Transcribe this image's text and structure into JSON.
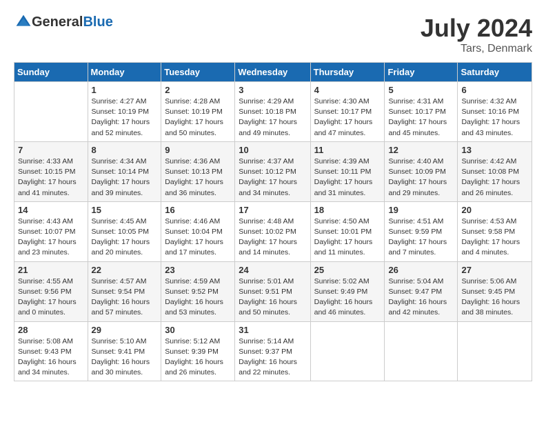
{
  "header": {
    "logo_general": "General",
    "logo_blue": "Blue",
    "month_year": "July 2024",
    "location": "Tars, Denmark"
  },
  "days_of_week": [
    "Sunday",
    "Monday",
    "Tuesday",
    "Wednesday",
    "Thursday",
    "Friday",
    "Saturday"
  ],
  "weeks": [
    [
      {
        "day": "",
        "sunrise": "",
        "sunset": "",
        "daylight": ""
      },
      {
        "day": "1",
        "sunrise": "Sunrise: 4:27 AM",
        "sunset": "Sunset: 10:19 PM",
        "daylight": "Daylight: 17 hours and 52 minutes."
      },
      {
        "day": "2",
        "sunrise": "Sunrise: 4:28 AM",
        "sunset": "Sunset: 10:19 PM",
        "daylight": "Daylight: 17 hours and 50 minutes."
      },
      {
        "day": "3",
        "sunrise": "Sunrise: 4:29 AM",
        "sunset": "Sunset: 10:18 PM",
        "daylight": "Daylight: 17 hours and 49 minutes."
      },
      {
        "day": "4",
        "sunrise": "Sunrise: 4:30 AM",
        "sunset": "Sunset: 10:17 PM",
        "daylight": "Daylight: 17 hours and 47 minutes."
      },
      {
        "day": "5",
        "sunrise": "Sunrise: 4:31 AM",
        "sunset": "Sunset: 10:17 PM",
        "daylight": "Daylight: 17 hours and 45 minutes."
      },
      {
        "day": "6",
        "sunrise": "Sunrise: 4:32 AM",
        "sunset": "Sunset: 10:16 PM",
        "daylight": "Daylight: 17 hours and 43 minutes."
      }
    ],
    [
      {
        "day": "7",
        "sunrise": "Sunrise: 4:33 AM",
        "sunset": "Sunset: 10:15 PM",
        "daylight": "Daylight: 17 hours and 41 minutes."
      },
      {
        "day": "8",
        "sunrise": "Sunrise: 4:34 AM",
        "sunset": "Sunset: 10:14 PM",
        "daylight": "Daylight: 17 hours and 39 minutes."
      },
      {
        "day": "9",
        "sunrise": "Sunrise: 4:36 AM",
        "sunset": "Sunset: 10:13 PM",
        "daylight": "Daylight: 17 hours and 36 minutes."
      },
      {
        "day": "10",
        "sunrise": "Sunrise: 4:37 AM",
        "sunset": "Sunset: 10:12 PM",
        "daylight": "Daylight: 17 hours and 34 minutes."
      },
      {
        "day": "11",
        "sunrise": "Sunrise: 4:39 AM",
        "sunset": "Sunset: 10:11 PM",
        "daylight": "Daylight: 17 hours and 31 minutes."
      },
      {
        "day": "12",
        "sunrise": "Sunrise: 4:40 AM",
        "sunset": "Sunset: 10:09 PM",
        "daylight": "Daylight: 17 hours and 29 minutes."
      },
      {
        "day": "13",
        "sunrise": "Sunrise: 4:42 AM",
        "sunset": "Sunset: 10:08 PM",
        "daylight": "Daylight: 17 hours and 26 minutes."
      }
    ],
    [
      {
        "day": "14",
        "sunrise": "Sunrise: 4:43 AM",
        "sunset": "Sunset: 10:07 PM",
        "daylight": "Daylight: 17 hours and 23 minutes."
      },
      {
        "day": "15",
        "sunrise": "Sunrise: 4:45 AM",
        "sunset": "Sunset: 10:05 PM",
        "daylight": "Daylight: 17 hours and 20 minutes."
      },
      {
        "day": "16",
        "sunrise": "Sunrise: 4:46 AM",
        "sunset": "Sunset: 10:04 PM",
        "daylight": "Daylight: 17 hours and 17 minutes."
      },
      {
        "day": "17",
        "sunrise": "Sunrise: 4:48 AM",
        "sunset": "Sunset: 10:02 PM",
        "daylight": "Daylight: 17 hours and 14 minutes."
      },
      {
        "day": "18",
        "sunrise": "Sunrise: 4:50 AM",
        "sunset": "Sunset: 10:01 PM",
        "daylight": "Daylight: 17 hours and 11 minutes."
      },
      {
        "day": "19",
        "sunrise": "Sunrise: 4:51 AM",
        "sunset": "Sunset: 9:59 PM",
        "daylight": "Daylight: 17 hours and 7 minutes."
      },
      {
        "day": "20",
        "sunrise": "Sunrise: 4:53 AM",
        "sunset": "Sunset: 9:58 PM",
        "daylight": "Daylight: 17 hours and 4 minutes."
      }
    ],
    [
      {
        "day": "21",
        "sunrise": "Sunrise: 4:55 AM",
        "sunset": "Sunset: 9:56 PM",
        "daylight": "Daylight: 17 hours and 0 minutes."
      },
      {
        "day": "22",
        "sunrise": "Sunrise: 4:57 AM",
        "sunset": "Sunset: 9:54 PM",
        "daylight": "Daylight: 16 hours and 57 minutes."
      },
      {
        "day": "23",
        "sunrise": "Sunrise: 4:59 AM",
        "sunset": "Sunset: 9:52 PM",
        "daylight": "Daylight: 16 hours and 53 minutes."
      },
      {
        "day": "24",
        "sunrise": "Sunrise: 5:01 AM",
        "sunset": "Sunset: 9:51 PM",
        "daylight": "Daylight: 16 hours and 50 minutes."
      },
      {
        "day": "25",
        "sunrise": "Sunrise: 5:02 AM",
        "sunset": "Sunset: 9:49 PM",
        "daylight": "Daylight: 16 hours and 46 minutes."
      },
      {
        "day": "26",
        "sunrise": "Sunrise: 5:04 AM",
        "sunset": "Sunset: 9:47 PM",
        "daylight": "Daylight: 16 hours and 42 minutes."
      },
      {
        "day": "27",
        "sunrise": "Sunrise: 5:06 AM",
        "sunset": "Sunset: 9:45 PM",
        "daylight": "Daylight: 16 hours and 38 minutes."
      }
    ],
    [
      {
        "day": "28",
        "sunrise": "Sunrise: 5:08 AM",
        "sunset": "Sunset: 9:43 PM",
        "daylight": "Daylight: 16 hours and 34 minutes."
      },
      {
        "day": "29",
        "sunrise": "Sunrise: 5:10 AM",
        "sunset": "Sunset: 9:41 PM",
        "daylight": "Daylight: 16 hours and 30 minutes."
      },
      {
        "day": "30",
        "sunrise": "Sunrise: 5:12 AM",
        "sunset": "Sunset: 9:39 PM",
        "daylight": "Daylight: 16 hours and 26 minutes."
      },
      {
        "day": "31",
        "sunrise": "Sunrise: 5:14 AM",
        "sunset": "Sunset: 9:37 PM",
        "daylight": "Daylight: 16 hours and 22 minutes."
      },
      {
        "day": "",
        "sunrise": "",
        "sunset": "",
        "daylight": ""
      },
      {
        "day": "",
        "sunrise": "",
        "sunset": "",
        "daylight": ""
      },
      {
        "day": "",
        "sunrise": "",
        "sunset": "",
        "daylight": ""
      }
    ]
  ]
}
